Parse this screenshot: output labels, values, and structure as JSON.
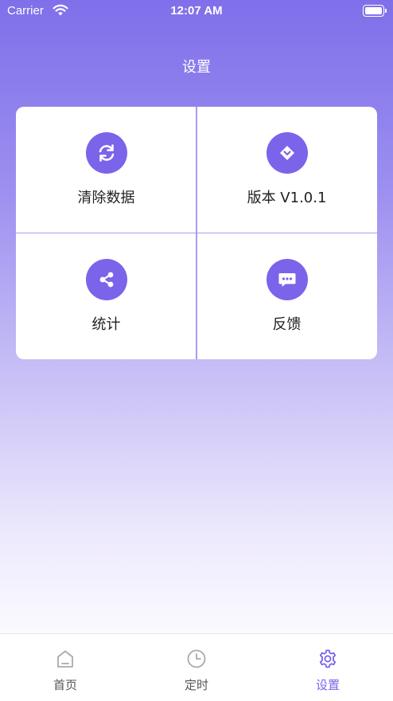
{
  "status_bar": {
    "carrier": "Carrier",
    "time": "12:07 AM"
  },
  "header": {
    "title": "设置"
  },
  "grid": {
    "items": [
      {
        "label": "清除数据",
        "icon": "refresh-icon"
      },
      {
        "label": "版本 V1.0.1",
        "icon": "diamond-icon"
      },
      {
        "label": "统计",
        "icon": "share-icon"
      },
      {
        "label": "反馈",
        "icon": "chat-icon"
      }
    ]
  },
  "tab_bar": {
    "tabs": [
      {
        "label": "首页",
        "icon": "home-icon"
      },
      {
        "label": "定时",
        "icon": "clock-icon"
      },
      {
        "label": "设置",
        "icon": "gear-icon",
        "active": true
      }
    ]
  },
  "colors": {
    "accent": "#7b63ea",
    "gradient_top": "#7f6fea",
    "divider": "#a99cf0"
  }
}
